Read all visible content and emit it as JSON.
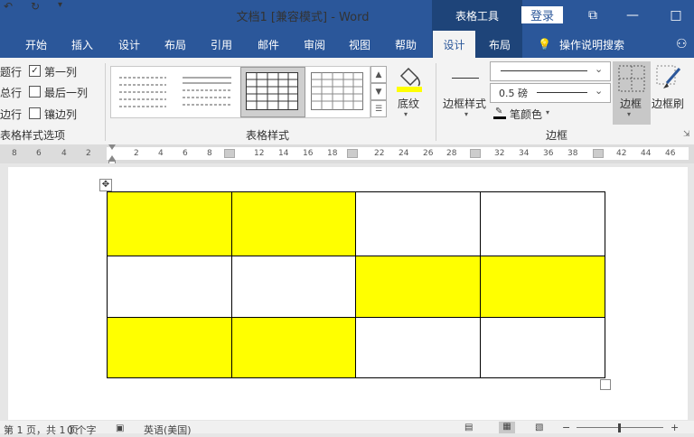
{
  "titlebar": {
    "title": "文档1 [兼容模式]  -  Word",
    "table_tools": "表格工具",
    "login": "登录",
    "undo_icon": "undo-icon",
    "redo_icon": "redo-icon",
    "restore": "□",
    "minimize": "—",
    "maximize": "□"
  },
  "tabs": [
    "开始",
    "插入",
    "设计",
    "布局",
    "引用",
    "邮件",
    "审阅",
    "视图",
    "帮助",
    "设计",
    "布局"
  ],
  "tell_me": "操作说明搜索",
  "ribbon": {
    "options": {
      "rows": [
        {
          "label": "题行",
          "checked": null
        },
        {
          "label": "总行",
          "checked": null
        },
        {
          "label": "边行",
          "checked": null
        }
      ],
      "right_rows": [
        {
          "label": "第一列",
          "checked": true
        },
        {
          "label": "最后一列",
          "checked": false
        },
        {
          "label": "镶边列",
          "checked": false
        }
      ],
      "group_label": "表格样式选项",
      "check_mark": "✓"
    },
    "styles": {
      "group_label": "表格样式"
    },
    "shading": {
      "label": "底纹",
      "color": "#ffff00"
    },
    "borders": {
      "border_styles": "边框样式",
      "weight": "0.5 磅",
      "pen_color": "笔颜色",
      "border_btn": "边框",
      "painter": "边框刷",
      "group_label": "边框"
    }
  },
  "ruler": {
    "numbers": [
      "8",
      "6",
      "4",
      "2",
      "2",
      "4",
      "6",
      "8",
      "12",
      "14",
      "16",
      "18",
      "22",
      "24",
      "26",
      "28",
      "32",
      "34",
      "36",
      "38",
      "42",
      "44",
      "46"
    ]
  },
  "table": {
    "fill_color": "#ffff00",
    "rows": [
      [
        true,
        true,
        false,
        false
      ],
      [
        false,
        false,
        true,
        true
      ],
      [
        true,
        true,
        false,
        false
      ]
    ]
  },
  "statusbar": {
    "page": "第 1 页，共 1 页",
    "words": "0 个字",
    "language": "英语(美国)"
  }
}
